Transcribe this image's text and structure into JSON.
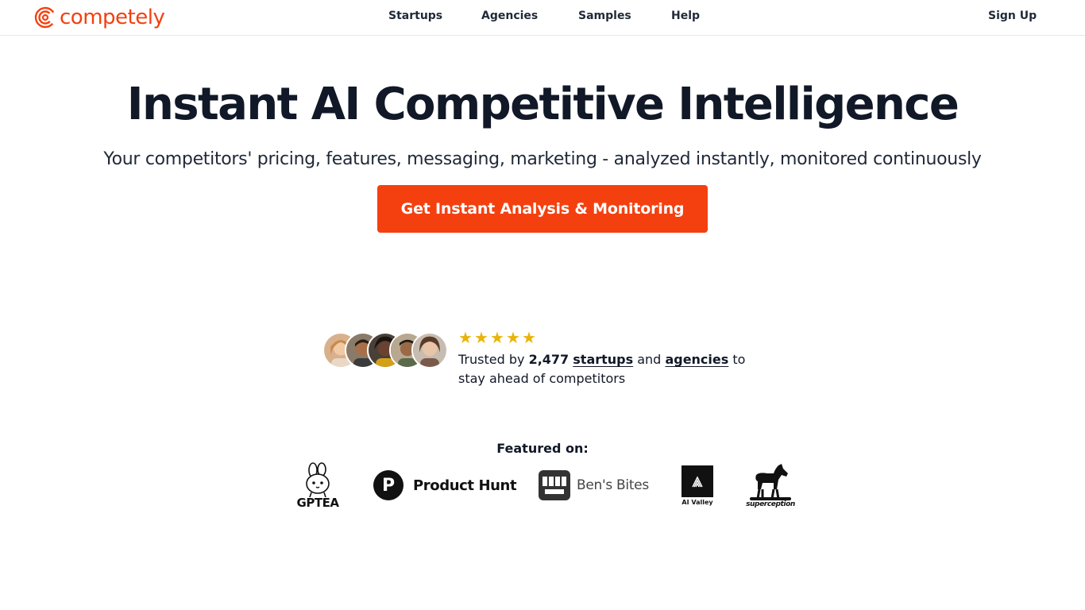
{
  "brand": {
    "name": "competely",
    "color": "#f4400f"
  },
  "nav": {
    "startups": "Startups",
    "agencies": "Agencies",
    "samples": "Samples",
    "help": "Help",
    "signup": "Sign Up"
  },
  "hero": {
    "title": "Instant AI Competitive Intelligence",
    "subtitle": "Your competitors' pricing, features, messaging, marketing - analyzed instantly, monitored continuously",
    "cta_label": "Get Instant Analysis & Monitoring"
  },
  "social_proof": {
    "rating": 5,
    "text_prefix": "Trusted by",
    "count": "2,477",
    "startups_link": "startups",
    "and": "and",
    "agencies_link": "agencies",
    "text_suffix": "to stay ahead of competitors",
    "avatar_count": 5
  },
  "featured": {
    "label": "Featured on:",
    "logos": {
      "gptea": "GPTEA",
      "product_hunt": "Product Hunt",
      "product_hunt_letter": "P",
      "bens_bites": "Ben's Bites",
      "ai_valley": "AI Valley",
      "superception": "superception"
    }
  }
}
